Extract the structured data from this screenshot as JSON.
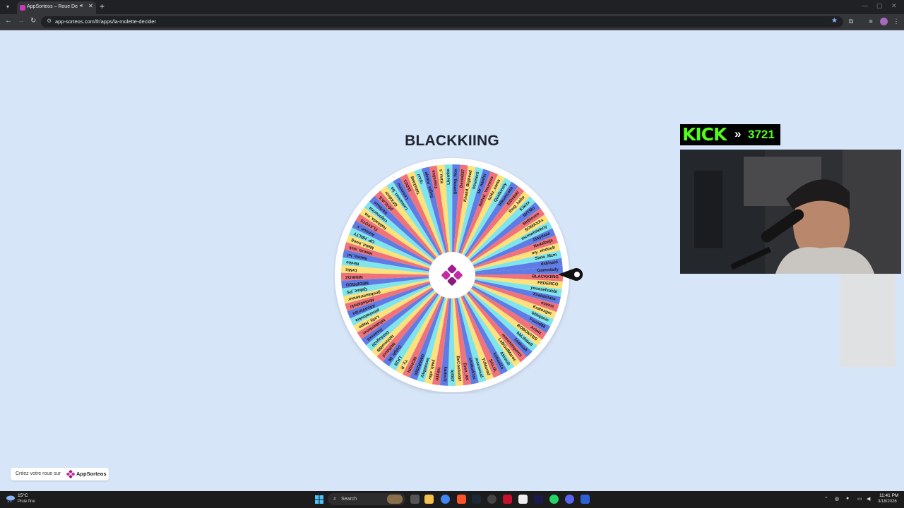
{
  "browser": {
    "tab_title": "AppSorteos – Roue De La Chance",
    "url": "app-sorteos.com/fr/apps/la-molette-decider"
  },
  "wheel": {
    "winner": "BLACKKIING",
    "colors": [
      "#5f7ce6",
      "#f0727a",
      "#fde17a",
      "#7fe5ec"
    ],
    "names": [
      "Gamedaily",
      "BLACKKIING",
      "FEDERCO",
      "youssefsahbi",
      "Xxabdelahx",
      "mamie",
      "Kratoxgm",
      "bblajanie",
      "Found88",
      "Ariwiz",
      "BOBONYBS",
      "bbLifebell",
      "1sakuaA",
      "mmwhitsports",
      "LeBGofMaroc",
      "Akimob",
      "kobaal2a",
      "SALUL",
      "TVMorad",
      "moumoud",
      "chokodrizz",
      "Eren_AK",
      "BeCoolio007",
      "lol007",
      "karim7l",
      "tekyyo",
      "yaab_elliv",
      "lamatilbyy",
      "OMAR2020",
      "MOHSIN",
      "Yy_R",
      "LK29",
      "Dolph_00",
      "Noffdoof",
      "lahhmoiBB",
      "Diddogs30",
      "ihsanxxtl",
      "tahabenbeux",
      "Lelly_Hapo",
      "pinchaloukia",
      "AllonVirriba",
      "Mrdistlaheki",
      "genbaumrameur",
      "Qakee_PS",
      "MEDIPROD",
      "NINIKOZ",
      "DrMiz",
      "Niniko",
      "Naima_lol",
      "Hamza_sick",
      "Mahd_hoog",
      "OP_HRLTY",
      "Amoun_x",
      "FLAYOTS",
      "Hakkada_ma",
      "ciajonarina",
      "Kerbozo",
      "pDXLiKS",
      "GFXdoor",
      "Lamaison_ba",
      "Leoxxmu",
      "1k2t21",
      "Taba1aag",
      "rpxxl",
      "Sugoi_Alpaje",
      "Fasm0sa",
      "Kinu_s",
      "Lkemba",
      "gaming_Nox",
      "Dexta037",
      "Khalid_Bighead",
      "bsumer0",
      "Mr_nawfel",
      "Ibtihal_Youness",
      "tuHu_sama",
      "Qualkmely",
      "Hikumcasa",
      "ElDidaki",
      "thug_kaito",
      "Kikizx",
      "MrTMo",
      "MrBloxee",
      "SOMAXAx",
      "mcmwhiteboy",
      "J3aydaaa",
      "Nedalbaja",
      "my_elrdoub",
      "Simo_Mzm",
      "dablsaid"
    ]
  },
  "kick": {
    "logo": "KICK",
    "arrow": "»",
    "count": "3721"
  },
  "badge": {
    "text": "Créez votre roue sur",
    "brand": "AppSorteos"
  },
  "taskbar": {
    "temp": "15°C",
    "condition": "Pluie fine",
    "search": "Search",
    "time": "11:41 PM",
    "date": "3/18/2026"
  }
}
